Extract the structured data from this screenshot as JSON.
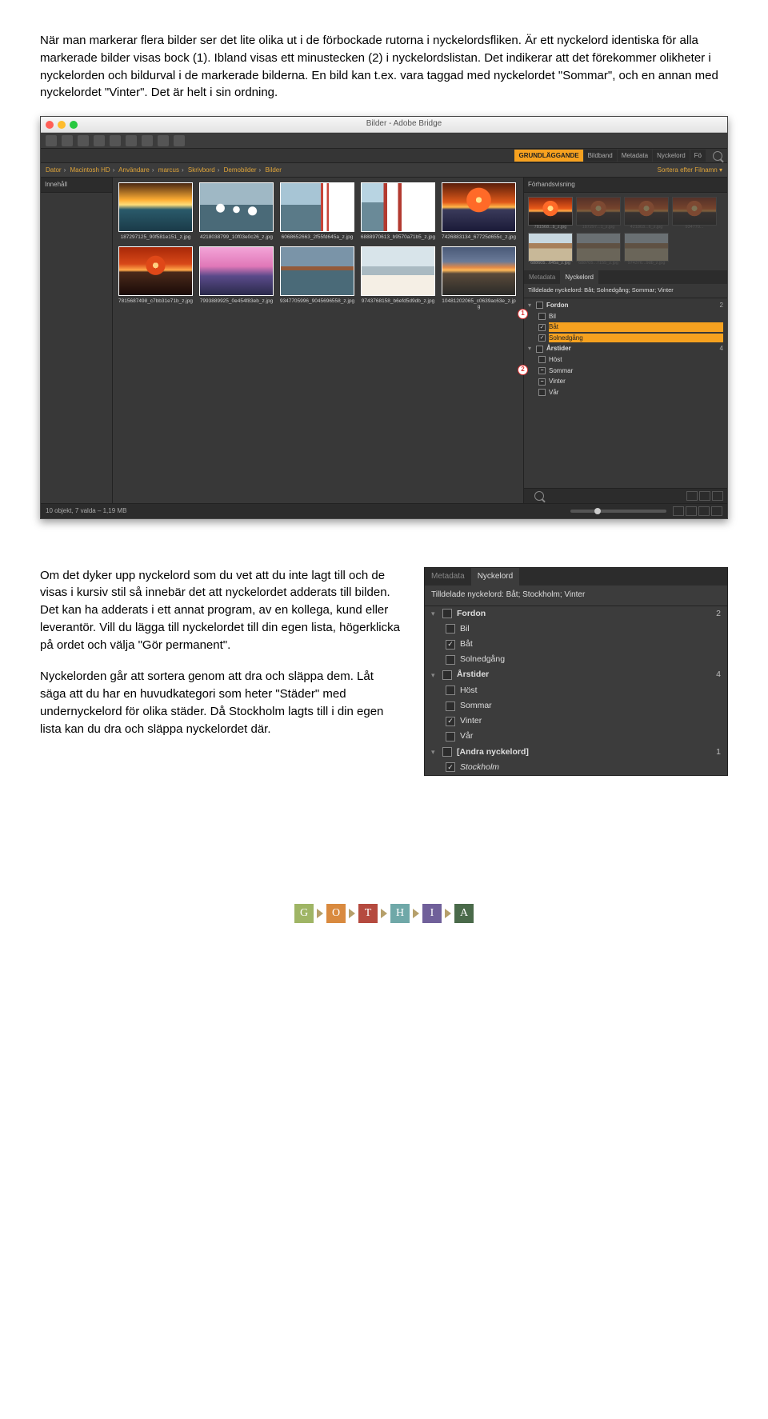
{
  "para1": "När man markerar flera bilder ser det lite olika ut i de förbockade rutorna i nyckelordsfliken. Är ett nyckelord identiska för alla markerade bilder visas bock (1). Ibland visas ett minustecken (2) i nyckelordslistan. Det indikerar att det förekommer olikheter i nyckelorden och bildurval i de markerade bilderna. En bild kan t.ex. vara taggad med nyckelordet \"Sommar\", och en annan med nyckelordet \"Vinter\". Det är helt i sin ordning.",
  "bridge": {
    "windowTitle": "Bilder - Adobe Bridge",
    "tabs": {
      "t1": "GRUNDLÄGGANDE",
      "t2": "Bildband",
      "t3": "Metadata",
      "t4": "Nyckelord",
      "t5": "Fö"
    },
    "crumbs": {
      "c1": "Dator",
      "c2": "Macintosh HD",
      "c3": "Användare",
      "c4": "marcus",
      "c5": "Skrivbord",
      "c6": "Demobilder",
      "c7": "Bilder"
    },
    "sort": "Sortera efter Filnamn ▾",
    "leftPanel": "Innehåll",
    "previewPanel": "Förhandsvisning",
    "thumbs": [
      "187297125_90f581e151_z.jpg",
      "4218038799_10f03e0c26_z.jpg",
      "6068652663_2f55fd645a_z.jpg",
      "6888970613_b9570a71b5_z.jpg",
      "7426883134_67725d655c_z.jpg",
      "7815687498_c7bb31e71b_z.jpg",
      "7993889925_0e454f83eb_z.jpg",
      "9347705996_9045696558_z.jpg",
      "9743768158_b6efd5d9db_z.jpg",
      "10481202065_c0639ac63e_z.jpg"
    ],
    "minis": {
      "m1": "781568...b_z.jpg",
      "m2": "187297...1_z.jpg",
      "m3": "421803...6_z.jpg",
      "m4": "934770...",
      "m5": "688605...645a_z.jpg",
      "m6": "688705...7155_z.jpg",
      "m7": "974376...9db_z.jpg"
    },
    "kwTabMeta": "Metadata",
    "kwTabKw": "Nyckelord",
    "assigned": "Tilldelade nyckelord: Båt; Solnedgång; Sommar; Vinter",
    "kw": {
      "fordon": "Fordon",
      "bil": "Bil",
      "bat": "Båt",
      "sol": "Solnedgång",
      "arstider": "Årstider",
      "host": "Höst",
      "sommar": "Sommar",
      "vinter": "Vinter",
      "var": "Vår",
      "fordonCnt": "2",
      "arstiderCnt": "4"
    },
    "badge1": "1",
    "badge2": "2",
    "status": "10 objekt, 7 valda – 1,19 MB"
  },
  "para2": "Om det dyker upp nyckelord som du vet att du inte lagt till och de visas i kursiv stil så innebär det att nyckelordet adderats till bilden. Det kan ha adderats i ett annat program, av en kollega, kund eller leverantör. Vill du lägga till nyckelordet till din egen lista, högerklicka på ordet och välja \"Gör permanent\".",
  "para3": "Nyckelorden går att sortera genom att dra och släppa dem. Låt säga att du har en huvudkategori som heter \"Städer\" med undernyckelord för olika städer. Då Stockholm lagts till i din egen lista kan du dra och släppa nyckelordet där.",
  "crop": {
    "tabMeta": "Metadata",
    "tabKw": "Nyckelord",
    "assigned": "Tilldelade nyckelord: Båt; Stockholm; Vinter",
    "fordon": "Fordon",
    "fordonCnt": "2",
    "bil": "Bil",
    "bat": "Båt",
    "sol": "Solnedgång",
    "arstider": "Årstider",
    "arstiderCnt": "4",
    "host": "Höst",
    "sommar": "Sommar",
    "vinter": "Vinter",
    "var": "Vår",
    "andra": "[Andra nyckelord]",
    "andraCnt": "1",
    "stockholm": "Stockholm"
  },
  "logo": {
    "g": "G",
    "o": "O",
    "t": "T",
    "h": "H",
    "i": "I",
    "a": "A"
  }
}
